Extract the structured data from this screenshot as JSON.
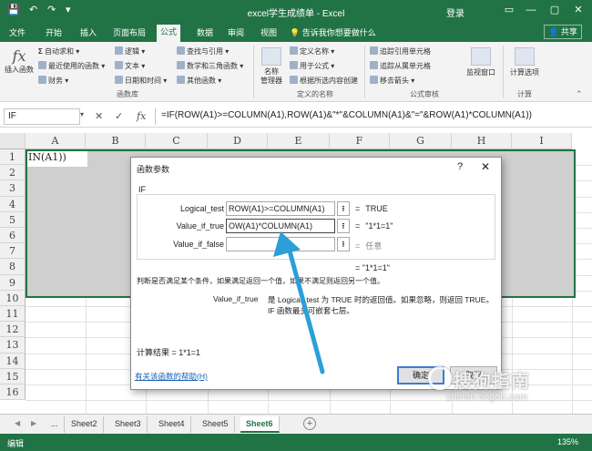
{
  "titlebar": {
    "title": "excel学生成绩单 - Excel",
    "login": "登录",
    "save_icon": "save-icon",
    "undo_icon": "undo-icon",
    "redo_icon": "redo-icon"
  },
  "tabs": [
    "文件",
    "开始",
    "插入",
    "页面布局",
    "公式",
    "数据",
    "审阅",
    "视图"
  ],
  "active_tab": "公式",
  "tellme": "告诉我你想要做什么",
  "share": "共享",
  "ribbon": {
    "insert_function": "插入函数",
    "autosum": "自动求和",
    "recent": "最近使用的函数",
    "financial": "财务",
    "logical": "逻辑",
    "text": "文本",
    "datetime": "日期和时间",
    "lookup": "查找与引用",
    "math": "数学和三角函数",
    "other": "其他函数",
    "library_label": "函数库",
    "name_manager": "名称\n管理器",
    "define_name": "定义名称",
    "use_in_formula": "用于公式",
    "create_from_selection": "根据所选内容创建",
    "defined_names_label": "定义的名称",
    "trace_precedents": "追踪引用单元格",
    "trace_dependents": "追踪从属单元格",
    "remove_arrows": "移去箭头",
    "audit_label": "公式审核",
    "watch_window": "监视窗口",
    "calc_options": "计算选项",
    "calc_label": "计算"
  },
  "formula_bar": {
    "name_box": "IF",
    "cancel": "✕",
    "enter": "✓",
    "fx": "fx",
    "formula": "=IF(ROW(A1)>=COLUMN(A1),ROW(A1)&\"*\"&COLUMN(A1)&\"=\"&ROW(A1)*COLUMN(A1))"
  },
  "grid": {
    "columns": [
      "A",
      "B",
      "C",
      "D",
      "E",
      "F",
      "G",
      "H",
      "I"
    ],
    "rows": [
      "1",
      "2",
      "3",
      "4",
      "5",
      "6",
      "7",
      "8",
      "9",
      "10",
      "11",
      "12",
      "13",
      "14",
      "15",
      "16"
    ],
    "a1_text": "IN(A1))"
  },
  "dialog": {
    "title": "函数参数",
    "help": "?",
    "close": "✕",
    "function_name": "IF",
    "args": [
      {
        "label": "Logical_test",
        "value": "ROW(A1)>=COLUMN(A1)",
        "result": "TRUE"
      },
      {
        "label": "Value_if_true",
        "value": "OW(A1)*COLUMN(A1)",
        "result": "\"1*1=1\""
      },
      {
        "label": "Value_if_false",
        "value": "",
        "result": "任意"
      }
    ],
    "eq": "=",
    "overall_result": "= \"1*1=1\"",
    "description": "判断是否满足某个条件，如果满足返回一个值，如果不满足则返回另一个值。",
    "param_name": "Value_if_true",
    "param_desc": "是 Logical_test 为 TRUE 时的返回值。如果忽略，则返回 TRUE。IF 函数最多可嵌套七层。",
    "calc_result": "计算结果 =   1*1=1",
    "help_link": "有关该函数的帮助(H)",
    "ok": "确定",
    "cancel": "取消"
  },
  "sheets": [
    "...",
    "Sheet2",
    "Sheet3",
    "Sheet4",
    "Sheet5",
    "Sheet6"
  ],
  "active_sheet": "Sheet6",
  "status": {
    "mode": "编辑",
    "zoom": "135%"
  },
  "watermark": {
    "main": "搜狗指南",
    "sub": "zhinan.sogou.com"
  },
  "colors": {
    "excel_green": "#217346",
    "arrow_blue": "#2c9fd8"
  }
}
